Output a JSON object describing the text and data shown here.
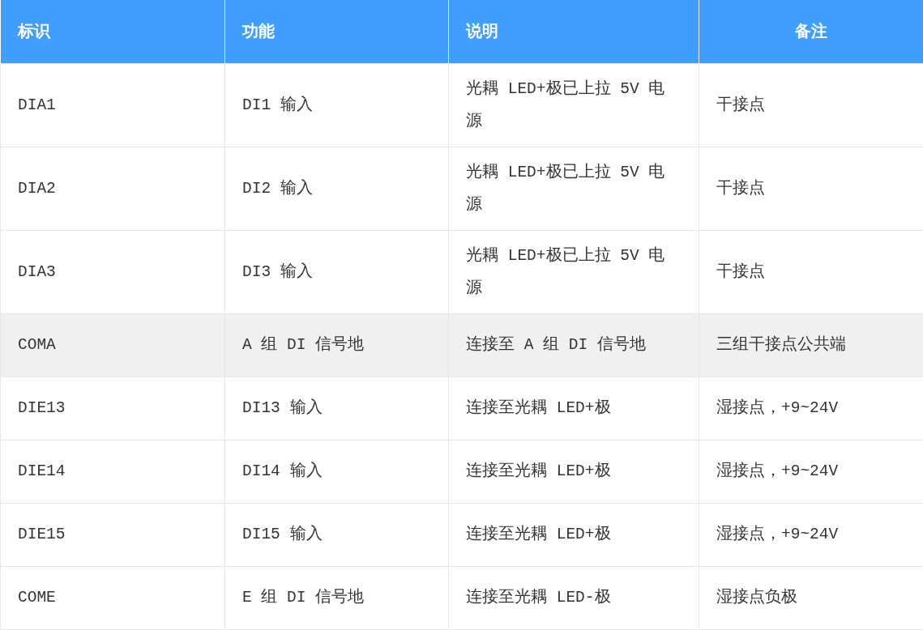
{
  "table": {
    "columns": [
      "标识",
      "功能",
      "说明",
      "备注"
    ],
    "rows": [
      {
        "highlighted": false,
        "cells": [
          "DIA1",
          "DI1 输入",
          "光耦 LED+极已上拉 5V 电源",
          "干接点"
        ]
      },
      {
        "highlighted": false,
        "cells": [
          "DIA2",
          "DI2 输入",
          "光耦 LED+极已上拉 5V 电源",
          "干接点"
        ]
      },
      {
        "highlighted": false,
        "cells": [
          "DIA3",
          "DI3 输入",
          "光耦 LED+极已上拉 5V 电源",
          "干接点"
        ]
      },
      {
        "highlighted": true,
        "cells": [
          "COMA",
          "A 组 DI 信号地",
          "连接至 A 组 DI 信号地",
          "三组干接点公共端"
        ]
      },
      {
        "highlighted": false,
        "cells": [
          "DIE13",
          "DI13 输入",
          "连接至光耦 LED+极",
          "湿接点，+9~24V"
        ]
      },
      {
        "highlighted": false,
        "cells": [
          "DIE14",
          "DI14 输入",
          "连接至光耦 LED+极",
          "湿接点，+9~24V"
        ]
      },
      {
        "highlighted": false,
        "cells": [
          "DIE15",
          "DI15 输入",
          "连接至光耦 LED+极",
          "湿接点，+9~24V"
        ]
      },
      {
        "highlighted": false,
        "cells": [
          "COME",
          "E 组 DI 信号地",
          "连接至光耦 LED-极",
          "湿接点负极"
        ]
      }
    ]
  }
}
